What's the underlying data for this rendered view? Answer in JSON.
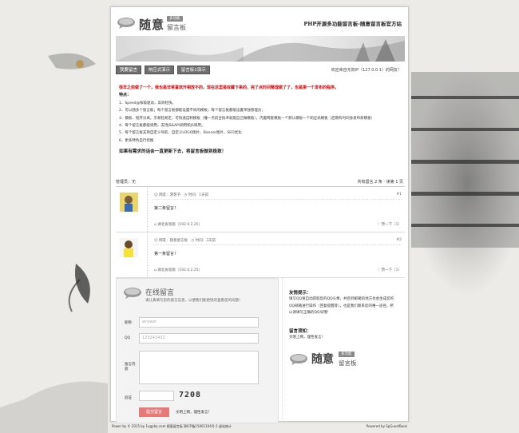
{
  "header": {
    "logo_main": "随意",
    "logo_tag": "多功能",
    "logo_board": "留言板",
    "site_title": "PHP开源多功能留言板-随意留言板官方站"
  },
  "nav": {
    "items": [
      {
        "label": "我要留言"
      },
      {
        "label": "响应式演示"
      },
      {
        "label": "留言板2演示"
      }
    ],
    "welcome": "欢迎来自无效IP（127.0.0.1）的网友！"
  },
  "notice": {
    "red_line": "很早之前做了一个，我也是非常喜欢开相放不的，现在这里是收藏下来的，完了点时间整理做了了，也是第一个发布的程序。",
    "features_title": "特点：",
    "features": [
      "1、Speed@核级驱动，高效轻快。",
      "2、可以随多个留言板；每个留言板都能设置不同的模板；每个留言板都能设置单独管理员；",
      "3、模板、程序分离，示易轻易定，可快速自制模板（懂一点前台技术就能自己做模板），内置两套模板一个默认模板一个响应式模板（后期有时间会发布新模板）",
      "4、每个留言板都能调用，支持JS&API调用和JS调用。",
      "5、每个留言板支持自定义导航、自定义LOGO图片、Banner图片、SEO优化",
      "6、更多特色自行挖掘"
    ],
    "closing": "如果有需求的话会一直更新下去，将留言板做到极致！"
  },
  "meta": {
    "admin": "管理员：无",
    "pager": "共有留言 2 条 · 读第 1 页"
  },
  "messages": [
    {
      "author": "网友：游客子",
      "time": "时间：1天前",
      "floor": "#1",
      "content": "第二条留言！",
      "location": "湖北省恩施（192.0.2.25）",
      "support": "赞一下（1）"
    },
    {
      "author": "网友：随意留言板",
      "time": "时间：3天前",
      "floor": "#2",
      "content": "第一条留言！",
      "location": "湖北省恩施（192.0.2.25）",
      "support": "赞一下（1）"
    }
  ],
  "form": {
    "title": "在线留言",
    "subtitle": "请认真填写您的留言信息，以便我们能更快的查看您的问题！",
    "nickname_label": "昵称",
    "nickname_value": "wrywer",
    "qq_label": "QQ",
    "qq_value": "123243432",
    "content_label": "留言内容",
    "captcha_label": "验证",
    "captcha_text": "7208",
    "submit_label": "提交留言",
    "submit_note": "文明上网，理性发言！"
  },
  "tips": {
    "title1": "友情提示：",
    "text1": "填写QQ将自动获取您的QQ头像，并且到邮箱的地方也会生成您的QQ邮箱进行操作（回复提醒等），也是我们联系您的唯一途径。所以请填写正确的QQ号哦！",
    "title2": "留言须知：",
    "text2": "文明上网，理性发言！"
  },
  "footer": {
    "left": "Power by © 2015 by 1ugphp.com 随意留言板 鄂ICP备15001104号-1 留站统计",
    "right": "Powered by SpGuestBook"
  }
}
